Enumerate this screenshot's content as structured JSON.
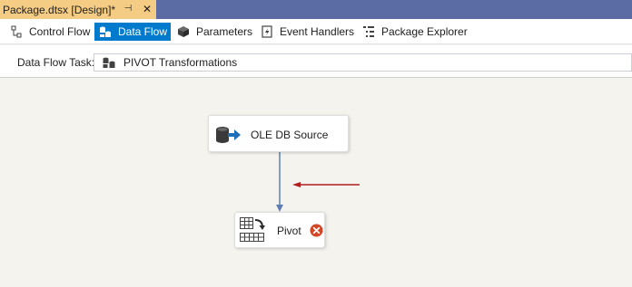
{
  "document_tab": {
    "title": "Package.dtsx [Design]*",
    "pin_glyph": "⊣",
    "close_glyph": "✕"
  },
  "designer_tabs": [
    {
      "label": "Control Flow",
      "icon": "control-flow-icon",
      "active": false
    },
    {
      "label": "Data Flow",
      "icon": "data-flow-icon",
      "active": true
    },
    {
      "label": "Parameters",
      "icon": "parameters-icon",
      "active": false
    },
    {
      "label": "Event Handlers",
      "icon": "event-handlers-icon",
      "active": false
    },
    {
      "label": "Package Explorer",
      "icon": "package-explorer-icon",
      "active": false
    }
  ],
  "task_row": {
    "label": "Data Flow Task:",
    "selected_task": "PIVOT Transformations"
  },
  "canvas": {
    "components": [
      {
        "name": "OLE DB Source",
        "icon": "ole-db-source-icon"
      },
      {
        "name": "Pivot",
        "icon": "pivot-icon",
        "status": "error",
        "status_icon": "error-icon"
      }
    ]
  },
  "colors": {
    "tab_strip": "#5b6ba3",
    "document_tab": "#f5cc84",
    "active_tab": "#007acc",
    "canvas": "#f5f3ee",
    "connector": "#5b7fb4",
    "annotation_arrow": "#b01e1e",
    "error": "#d24726"
  }
}
